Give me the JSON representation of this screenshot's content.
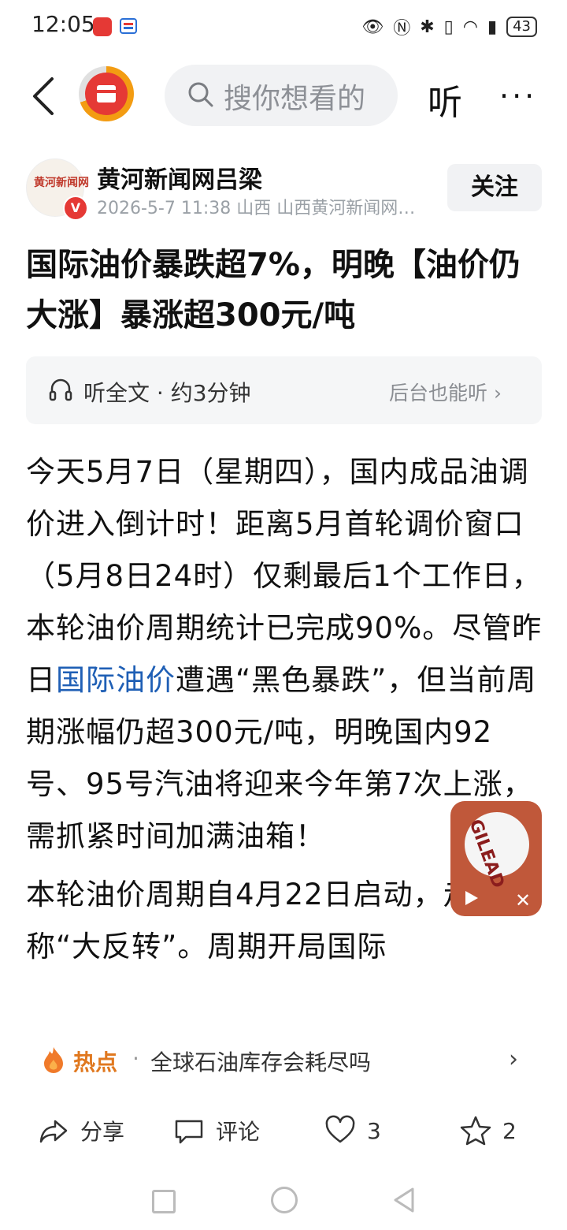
{
  "status_bar": {
    "time": "12:05",
    "battery": "43"
  },
  "top_bar": {
    "search_placeholder": "搜你想看的",
    "listen_label": "听",
    "more_label": "···"
  },
  "author": {
    "name": "黄河新闻网吕梁",
    "meta": "2026-5-7  11:38  山西  山西黄河新闻网…",
    "verified_badge": "V",
    "follow_label": "关注",
    "avatar_mark": "黄河新闻网"
  },
  "article": {
    "title": "国际油价暴跌超7%，明晚【油价仍大涨】暴涨超300元/吨",
    "listen_card": {
      "label": "听全文 · 约3分钟",
      "background_label": "后台也能听 ›"
    },
    "paragraph1_part1": "今天5月7日（星期四），国内成品油调价进入倒计时！距离5月首轮调价窗口（5月8日24时）仅剩最后1个工作日，本轮油价周期统计已完成90%。尽管昨日",
    "paragraph1_link": "国际油价",
    "paragraph1_part2": "遭遇“黑色暴跌”，但当前周期涨幅仍超300元/吨，明晚国内92号、95号汽油将迎来今年第7次上涨，",
    "paragraph1_part3": "需抓紧时间加满油箱！",
    "paragraph2": "本轮油价周期自4月22日启动，走势堪称“大反转”。周期开局国际"
  },
  "float_ad": {
    "brand_text": "GILEAD",
    "close_label": "✕"
  },
  "hot_bar": {
    "label": "热点",
    "separator": "·",
    "topic": "全球石油库存会耗尽吗",
    "arrow": "›"
  },
  "actions": {
    "share_label": "分享",
    "comment_label": "评论",
    "like_count": "3",
    "favorite_count": "2"
  },
  "colors": {
    "link": "#1f5fb5",
    "hot": "#e0781f",
    "brand_red": "#e53935"
  }
}
